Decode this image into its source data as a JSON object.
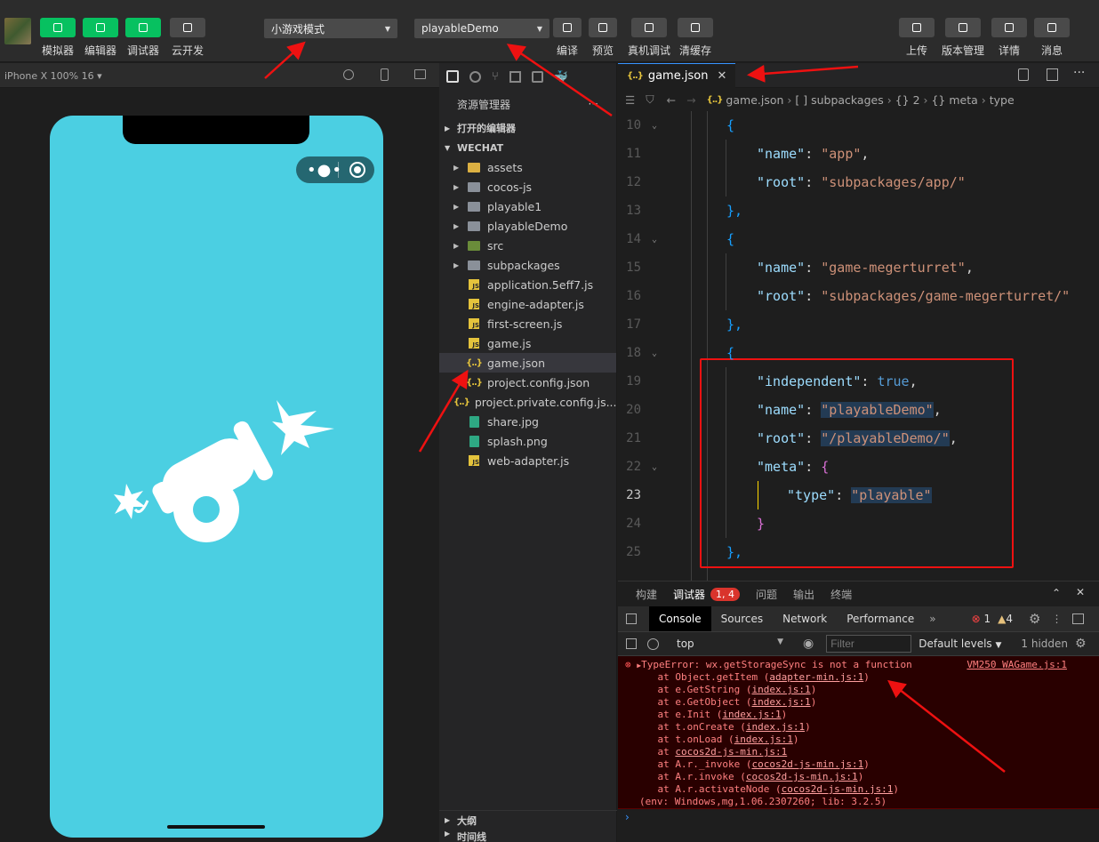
{
  "toolbar": {
    "left_buttons": [
      {
        "label": "模拟器",
        "icon": "phone-icon"
      },
      {
        "label": "编辑器",
        "icon": "code-icon"
      },
      {
        "label": "调试器",
        "icon": "debug-icon"
      },
      {
        "label": "云开发",
        "icon": "cloud-icon"
      }
    ],
    "mode_select": "小游戏模式",
    "compile_select": "playableDemo",
    "middle_buttons": [
      {
        "label": "编译",
        "icon": "refresh-icon"
      },
      {
        "label": "预览",
        "icon": "eye-icon"
      },
      {
        "label": "真机调试",
        "icon": "bug-icon"
      },
      {
        "label": "清缓存",
        "icon": "layers-icon"
      }
    ],
    "right_buttons": [
      {
        "label": "上传",
        "icon": "upload-icon"
      },
      {
        "label": "版本管理",
        "icon": "branch-icon"
      },
      {
        "label": "详情",
        "icon": "menu-icon"
      },
      {
        "label": "消息",
        "icon": "bell-icon"
      }
    ]
  },
  "simulator": {
    "device": "iPhone X 100% 16"
  },
  "explorer": {
    "title": "资源管理器",
    "open_editors": "打开的编辑器",
    "workspace": "WECHAT",
    "items": [
      {
        "name": "assets",
        "type": "folder-yellow"
      },
      {
        "name": "cocos-js",
        "type": "folder"
      },
      {
        "name": "playable1",
        "type": "folder"
      },
      {
        "name": "playableDemo",
        "type": "folder"
      },
      {
        "name": "src",
        "type": "folder-green"
      },
      {
        "name": "subpackages",
        "type": "folder"
      },
      {
        "name": "application.5eff7.js",
        "type": "js"
      },
      {
        "name": "engine-adapter.js",
        "type": "js"
      },
      {
        "name": "first-screen.js",
        "type": "js"
      },
      {
        "name": "game.js",
        "type": "js"
      },
      {
        "name": "game.json",
        "type": "json"
      },
      {
        "name": "project.config.json",
        "type": "json"
      },
      {
        "name": "project.private.config.js...",
        "type": "json"
      },
      {
        "name": "share.jpg",
        "type": "img"
      },
      {
        "name": "splash.png",
        "type": "img"
      },
      {
        "name": "web-adapter.js",
        "type": "js"
      }
    ],
    "outline": "大纲",
    "timeline": "时间线"
  },
  "editor": {
    "tab": "game.json",
    "breadcrumb": [
      "game.json",
      "[ ] subpackages",
      "{} 2",
      "{} meta",
      "type"
    ],
    "lines": [
      {
        "n": "10",
        "text": "{"
      },
      {
        "n": "11",
        "key": "\"name\"",
        "val": "\"app\"",
        "tail": ","
      },
      {
        "n": "12",
        "key": "\"root\"",
        "val": "\"subpackages/app/\""
      },
      {
        "n": "13",
        "text": "},"
      },
      {
        "n": "14",
        "text": "{"
      },
      {
        "n": "15",
        "key": "\"name\"",
        "val": "\"game-megerturret\"",
        "tail": ","
      },
      {
        "n": "16",
        "key": "\"root\"",
        "val": "\"subpackages/game-megerturret/\""
      },
      {
        "n": "17",
        "text": "},"
      },
      {
        "n": "18",
        "text": "{"
      },
      {
        "n": "19",
        "key": "\"independent\"",
        "val": "true",
        "tail": ","
      },
      {
        "n": "20",
        "key": "\"name\"",
        "val": "\"playableDemo\"",
        "tail": ","
      },
      {
        "n": "21",
        "key": "\"root\"",
        "val": "\"/playableDemo/\"",
        "tail": ","
      },
      {
        "n": "22",
        "key": "\"meta\"",
        "val": "{"
      },
      {
        "n": "23",
        "key": "\"type\"",
        "val": "\"playable\""
      },
      {
        "n": "24",
        "text": "}"
      },
      {
        "n": "25",
        "text": "},"
      }
    ]
  },
  "panel": {
    "tabs": [
      "构建",
      "调试器",
      "问题",
      "输出",
      "终端"
    ],
    "badge": "1, 4",
    "devtools_tabs": [
      "Console",
      "Sources",
      "Network",
      "Performance"
    ],
    "error_count": "1",
    "warn_count": "4",
    "context": "top",
    "filter_placeholder": "Filter",
    "levels": "Default levels",
    "hidden": "1 hidden",
    "error_source": "VM250 WAGame.js:1",
    "error_lines": [
      {
        "pre": "TypeError: wx.getStorageSync is not a function",
        "link": "",
        "post": ""
      },
      {
        "pre": "    at Object.getItem (",
        "link": "adapter-min.js:1",
        "post": ")"
      },
      {
        "pre": "    at e.GetString (",
        "link": "index.js:1",
        "post": ")"
      },
      {
        "pre": "    at e.GetObject (",
        "link": "index.js:1",
        "post": ")"
      },
      {
        "pre": "    at e.Init (",
        "link": "index.js:1",
        "post": ")"
      },
      {
        "pre": "    at t.onCreate (",
        "link": "index.js:1",
        "post": ")"
      },
      {
        "pre": "    at t.onLoad (",
        "link": "index.js:1",
        "post": ")"
      },
      {
        "pre": "    at ",
        "link": "cocos2d-js-min.js:1",
        "post": ""
      },
      {
        "pre": "    at A.r._invoke (",
        "link": "cocos2d-js-min.js:1",
        "post": ")"
      },
      {
        "pre": "    at A.r.invoke (",
        "link": "cocos2d-js-min.js:1",
        "post": ")"
      },
      {
        "pre": "    at A.r.activateNode (",
        "link": "cocos2d-js-min.js:1",
        "post": ")"
      }
    ],
    "env_line": "(env: Windows,mg,1.06.2307260; lib: 3.2.5)"
  },
  "colors": {
    "phone_bg": "#4bcfe2",
    "green": "#07c160",
    "highlight": "#e11111"
  }
}
